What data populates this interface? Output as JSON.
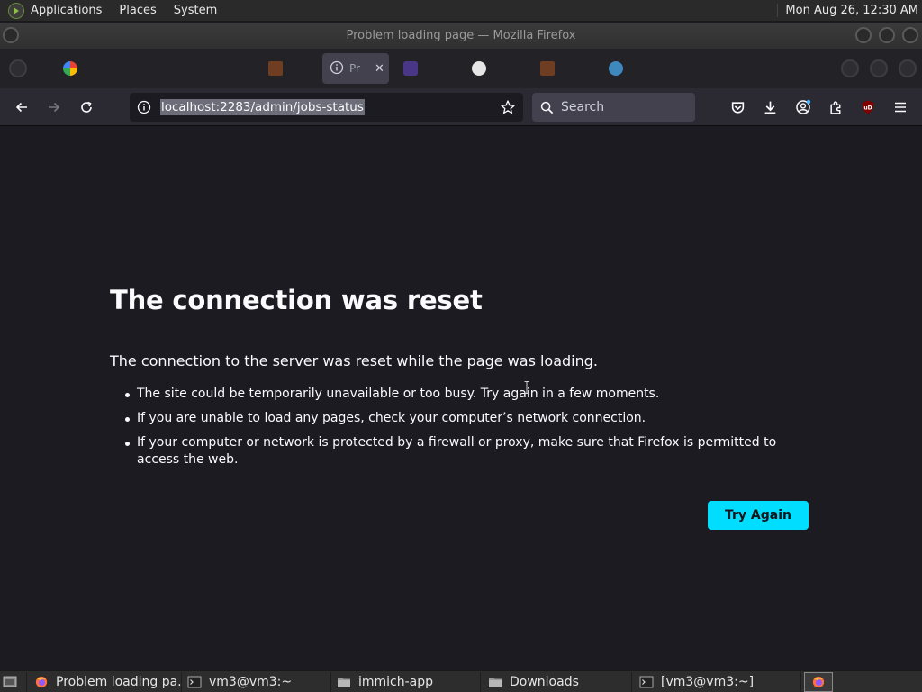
{
  "panel": {
    "menus": [
      "Applications",
      "Places",
      "System"
    ],
    "clock": "Mon Aug 26, 12:30 AM"
  },
  "window": {
    "title": "Problem loading page — Mozilla Firefox"
  },
  "tabs": {
    "active_label": "Pr",
    "close_glyph": "✕",
    "favicon_colors": [
      "#e94235",
      "#4285f4",
      "#cfcfd8",
      "#e8733a",
      "#7b61ff",
      "#f0f0f0",
      "#ff7139",
      "#4bb4ff"
    ]
  },
  "navbar": {
    "url": "localhost:2283/admin/jobs-status",
    "search_placeholder": "Search",
    "ublock_label": "uD"
  },
  "error_page": {
    "title": "The connection was reset",
    "description": "The connection to the server was reset while the page was loading.",
    "bullets": [
      "The site could be temporarily unavailable or too busy. Try again in a few moments.",
      "If you are unable to load any pages, check your computer’s network connection.",
      "If your computer or network is protected by a firewall or proxy, make sure that Firefox is permitted to access the web."
    ],
    "try_again_label": "Try Again"
  },
  "taskbar": {
    "items": [
      {
        "label": "Problem loading pa...",
        "icon": "firefox-icon"
      },
      {
        "label": "vm3@vm3:~",
        "icon": "terminal-icon"
      },
      {
        "label": "immich-app",
        "icon": "folder-icon"
      },
      {
        "label": "Downloads",
        "icon": "folder-icon"
      },
      {
        "label": "[vm3@vm3:~]",
        "icon": "terminal-icon"
      }
    ]
  },
  "colors": {
    "accent": "#00ddff",
    "page_background": "#1c1b22",
    "toolbar": "#2b2a33"
  }
}
